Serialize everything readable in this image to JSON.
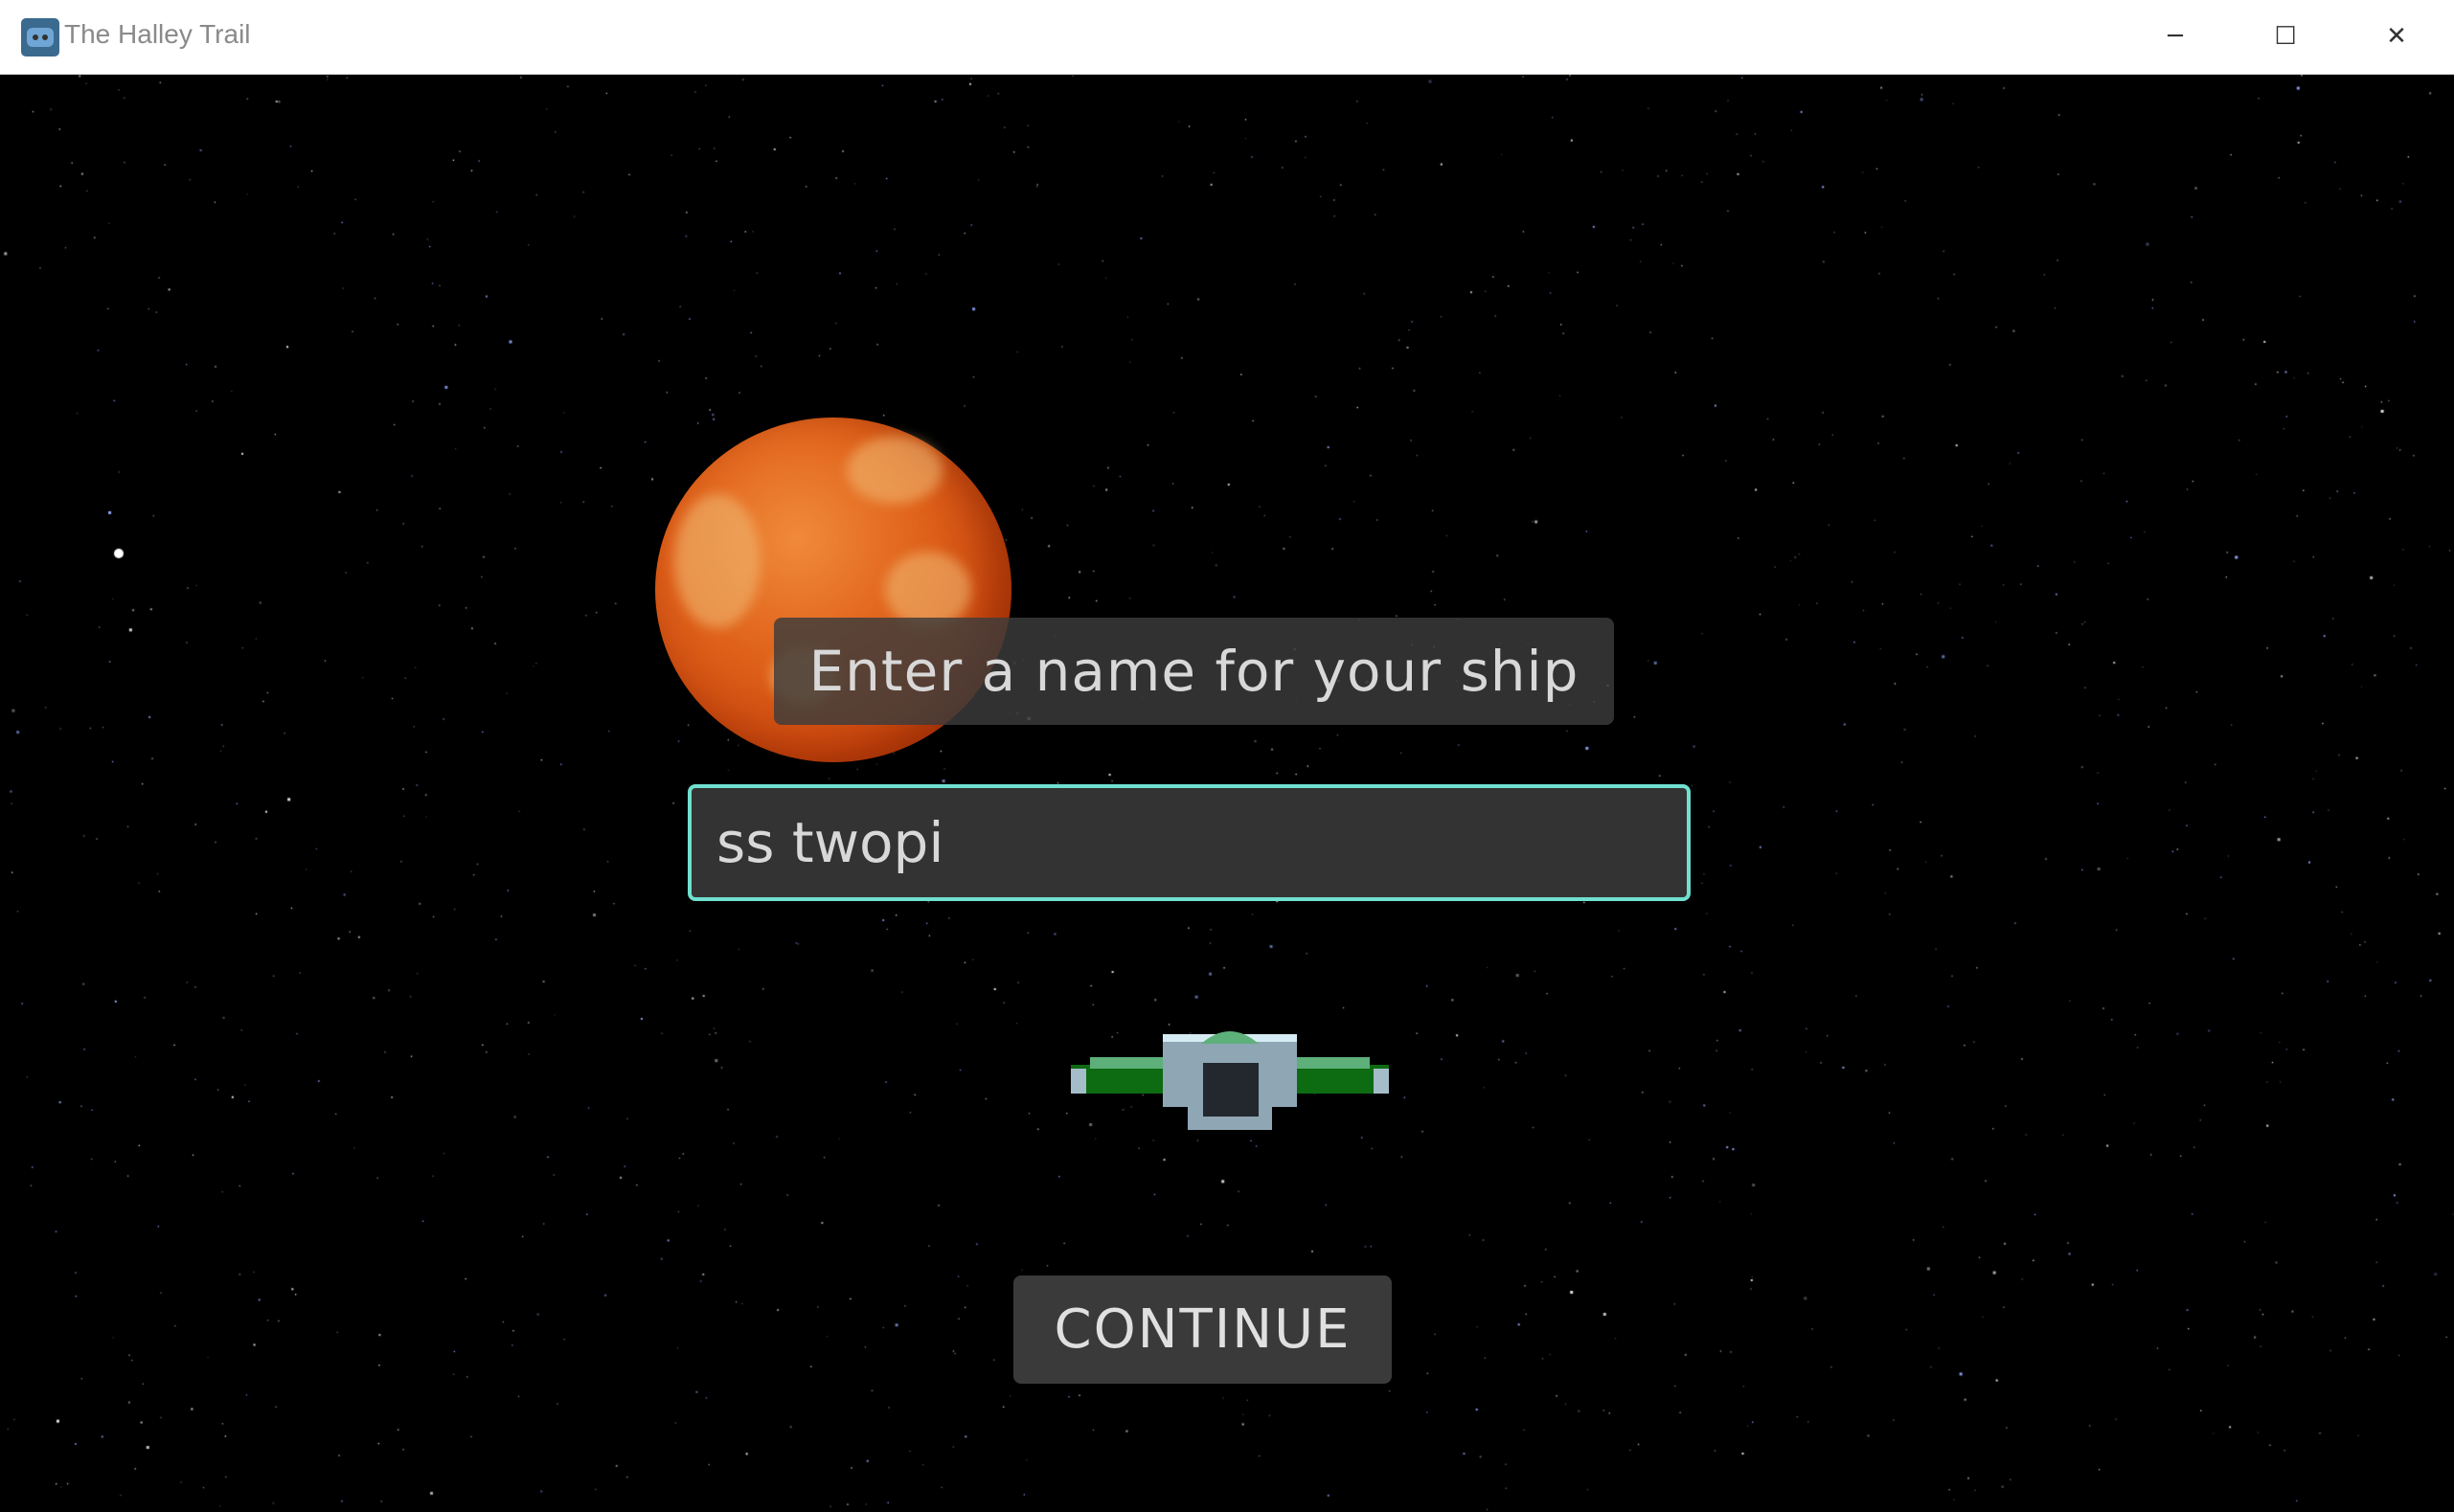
{
  "window": {
    "title": "The Halley Trail",
    "icon": "godot-engine-icon",
    "controls": {
      "minimize": "─",
      "maximize": "☐",
      "close": "✕"
    }
  },
  "game": {
    "prompt": "Enter a name for your ship",
    "ship_name_value": "ss twopi",
    "continue_label": "CONTINUE",
    "accent_color": "#6fe0cf",
    "planet_color": "#e0621a",
    "ship_colors": {
      "hull": "#8fa6b4",
      "wing": "#0d6b12",
      "dome": "#5eb07a",
      "window": "#22282e"
    }
  }
}
